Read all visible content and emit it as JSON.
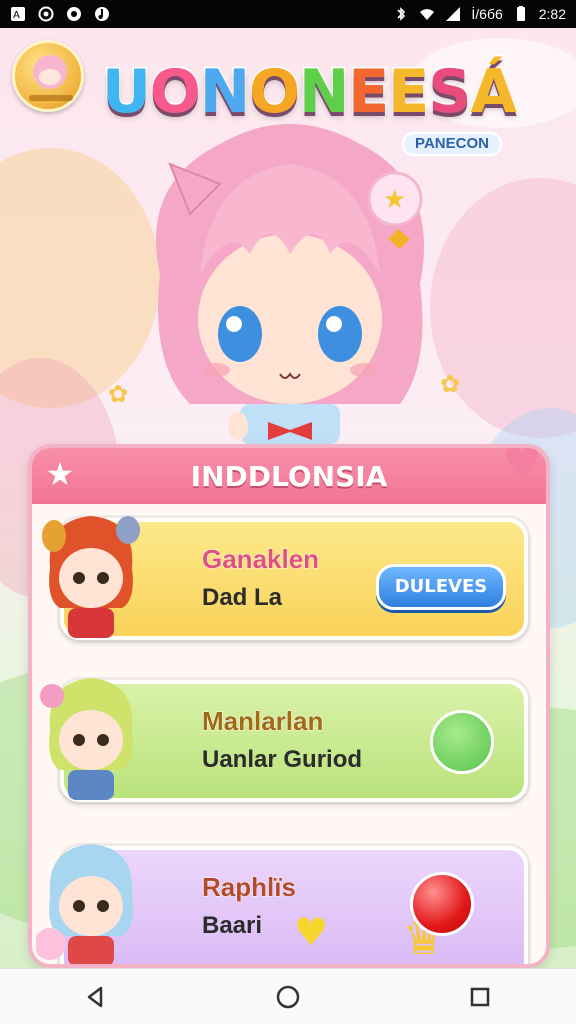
{
  "status_bar": {
    "time": "2:82",
    "carrier": "İ/6б6",
    "icons_left": [
      "app-icon",
      "circle-icon",
      "circle-icon",
      "music-icon"
    ],
    "icons_right": [
      "bluetooth-icon",
      "wifi-icon",
      "signal-icon",
      "battery-icon"
    ]
  },
  "header": {
    "title_letters": [
      "U",
      "O",
      "N",
      "O",
      "N",
      "E",
      "E",
      "S",
      "Á"
    ],
    "title_colors": [
      "#3fb6f2",
      "#f55a8a",
      "#4fa9f0",
      "#f5a623",
      "#5fcf4a",
      "#f2672f",
      "#f5b82a",
      "#e94c7c",
      "#f5b82a"
    ],
    "subtitle": "PANECON"
  },
  "panel": {
    "title": "INDDLONSIA"
  },
  "cards": [
    {
      "name": "Ganaklen",
      "sub": "Dad La",
      "button": "DULEVES"
    },
    {
      "name": "Manlarlan",
      "sub": "Uanlar Guriod"
    },
    {
      "name": "Raphlïs",
      "sub": "Baari"
    }
  ],
  "colors": {
    "panel_border": "#f3b2c5",
    "panel_header": "#f37596",
    "card1": "#f9d25a",
    "card2": "#b9e27c",
    "card3": "#d8b7f5",
    "button": "#2f7fe0"
  },
  "navbar": {
    "icons": [
      "back-icon",
      "home-icon",
      "recents-icon"
    ]
  }
}
